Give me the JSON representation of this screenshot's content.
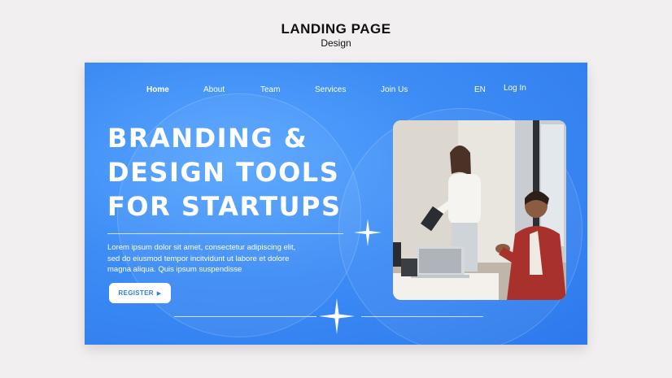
{
  "header": {
    "title": "LANDING PAGE",
    "subtitle": "Design"
  },
  "nav": {
    "items": [
      {
        "label": "Home"
      },
      {
        "label": "About"
      },
      {
        "label": "Team"
      },
      {
        "label": "Services"
      },
      {
        "label": "Join Us"
      }
    ],
    "language": "EN",
    "login": "Log In"
  },
  "hero": {
    "headline": [
      "BRANDING &",
      "DESIGN TOOLS",
      "FOR STARTUPS"
    ],
    "body": "Lorem ipsum dolor sit amet, consectetur adipiscing elit, sed do eiusmod tempor incitvidunt ut labore et dolore magna aliqua. Quis ipsum suspendisse",
    "register_label": "REGISTER",
    "register_arrow": "▶"
  },
  "icons": {
    "sparkle": "sparkle-icon",
    "arrow": "play-arrow-icon"
  },
  "colors": {
    "background": "#f1eff0",
    "primary": "#3d8cf5",
    "button_text": "#2e7bea"
  }
}
